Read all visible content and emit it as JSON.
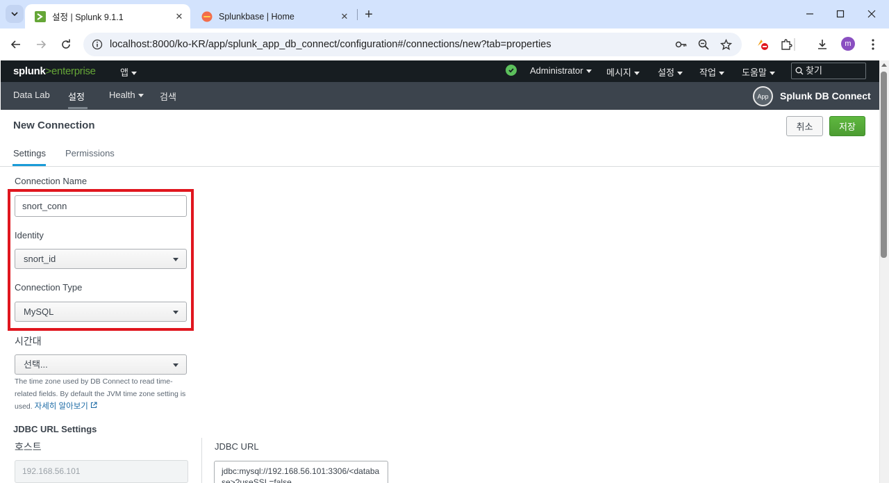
{
  "browser": {
    "tabs": [
      {
        "title": "설정 | Splunk 9.1.1",
        "active": true,
        "favicon": "splunk-favicon"
      },
      {
        "title": "Splunkbase | Home",
        "active": false,
        "favicon": "splunkbase-favicon"
      }
    ],
    "url": "localhost:8000/ko-KR/app/splunk_app_db_connect/configuration#/connections/new?tab=properties",
    "profile_initial": "m"
  },
  "splunk_bar": {
    "logo_prefix": "splunk",
    "logo_gt": ">",
    "logo_suffix": "enterprise",
    "apps_menu": "앱",
    "user_menu": "Administrator",
    "messages_menu": "메시지",
    "settings_menu": "설정",
    "activity_menu": "작업",
    "help_menu": "도움말",
    "find_placeholder": "찾기"
  },
  "app_bar": {
    "nav": [
      "Data Lab",
      "설정",
      "Health",
      "검색"
    ],
    "active_nav": "설정",
    "app_badge": "App",
    "app_name": "Splunk DB Connect"
  },
  "page": {
    "title": "New Connection",
    "cancel_label": "취소",
    "save_label": "저장",
    "tabs": [
      "Settings",
      "Permissions"
    ],
    "active_tab": "Settings"
  },
  "form": {
    "connection_name_label": "Connection Name",
    "connection_name_value": "snort_conn",
    "identity_label": "Identity",
    "identity_value": "snort_id",
    "connection_type_label": "Connection Type",
    "connection_type_value": "MySQL",
    "timezone_label": "시간대",
    "timezone_value": "선택...",
    "timezone_help": "The time zone used by DB Connect to read time-related fields. By default the JVM time zone setting is used.",
    "timezone_help_link": "자세히 알아보기",
    "jdbc_section_title": "JDBC URL Settings",
    "host_label": "호스트",
    "host_value": "192.168.56.101",
    "jdbc_url_label": "JDBC URL",
    "jdbc_url_value": "jdbc:mysql://192.168.56.101:3306/<database>?useSSL=false"
  },
  "colors": {
    "highlight_box": "#e0161e",
    "splunk_green": "#65a637",
    "save_button": "#5aa43c",
    "tab_active": "#1a9bd7"
  }
}
